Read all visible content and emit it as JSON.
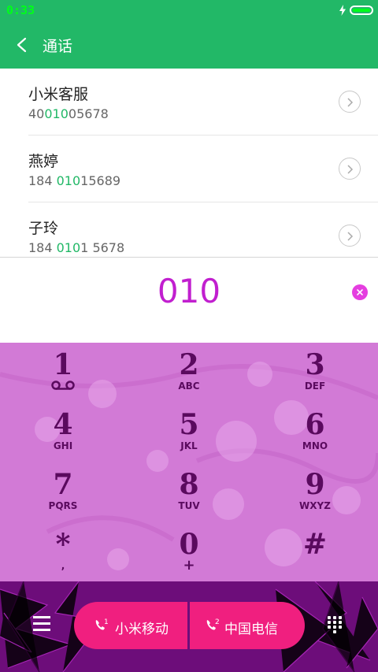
{
  "status": {
    "time": "0:33"
  },
  "header": {
    "title": "通话"
  },
  "contacts": [
    {
      "name": "小米客服",
      "number_pre": "40",
      "number_hl": "010",
      "number_post": "05678"
    },
    {
      "name": "燕婷",
      "number_pre": "184 ",
      "number_hl": "010",
      "number_post": "15689"
    },
    {
      "name": "子玲",
      "number_pre": "184 ",
      "number_hl": "010",
      "number_post": "1 5678"
    }
  ],
  "dial_input": {
    "value": "010"
  },
  "keypad": [
    {
      "digit": "1",
      "letters": ""
    },
    {
      "digit": "2",
      "letters": "ABC"
    },
    {
      "digit": "3",
      "letters": "DEF"
    },
    {
      "digit": "4",
      "letters": "GHI"
    },
    {
      "digit": "5",
      "letters": "JKL"
    },
    {
      "digit": "6",
      "letters": "MNO"
    },
    {
      "digit": "7",
      "letters": "PQRS"
    },
    {
      "digit": "8",
      "letters": "TUV"
    },
    {
      "digit": "9",
      "letters": "WXYZ"
    },
    {
      "digit": "*",
      "letters": ","
    },
    {
      "digit": "0",
      "letters": "+"
    },
    {
      "digit": "#",
      "letters": ""
    }
  ],
  "sim_buttons": [
    {
      "label": "小米移动",
      "slot": "1"
    },
    {
      "label": "中国电信",
      "slot": "2"
    }
  ],
  "colors": {
    "header_green": "#22b867",
    "accent_magenta": "#c11fcf",
    "keypad_bg": "#d27ad6",
    "sim_button": "#f01f7f",
    "highlight_green": "#22b867"
  }
}
